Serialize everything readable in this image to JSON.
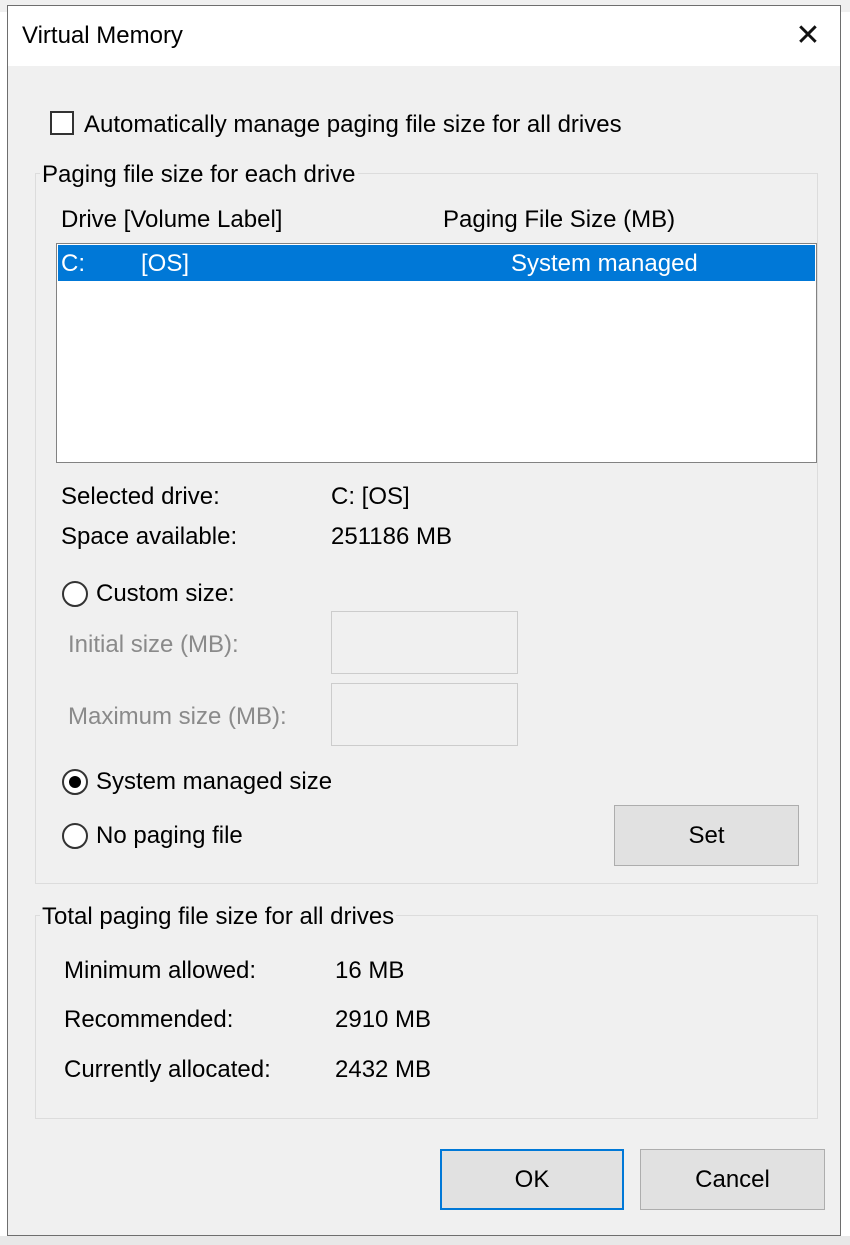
{
  "window": {
    "title": "Virtual Memory",
    "close_glyph": "✕"
  },
  "auto_manage": {
    "label": "Automatically manage paging file size for all drives",
    "checked": false
  },
  "drives_group": {
    "legend": "Paging file size for each drive",
    "col_drive": "Drive  [Volume Label]",
    "col_size": "Paging File Size (MB)",
    "rows": [
      {
        "drive": "C:",
        "label": "[OS]",
        "size": "System managed",
        "selected": true
      }
    ],
    "selected_drive_label": "Selected drive:",
    "selected_drive_value": "C:  [OS]",
    "space_available_label": "Space available:",
    "space_available_value": "251186 MB",
    "custom_size_label": "Custom size:",
    "initial_size_label": "Initial size (MB):",
    "initial_size_value": "",
    "maximum_size_label": "Maximum size (MB):",
    "maximum_size_value": "",
    "system_managed_label": "System managed size",
    "no_paging_label": "No paging file",
    "selected_option": "system_managed",
    "set_button": "Set"
  },
  "totals_group": {
    "legend": "Total paging file size for all drives",
    "minimum_label": "Minimum allowed:",
    "minimum_value": "16 MB",
    "recommended_label": "Recommended:",
    "recommended_value": "2910 MB",
    "allocated_label": "Currently allocated:",
    "allocated_value": "2432 MB"
  },
  "buttons": {
    "ok": "OK",
    "cancel": "Cancel"
  },
  "colors": {
    "selection": "#0078d7",
    "dialog_bg": "#f0f0f0",
    "button_bg": "#e1e1e1"
  }
}
